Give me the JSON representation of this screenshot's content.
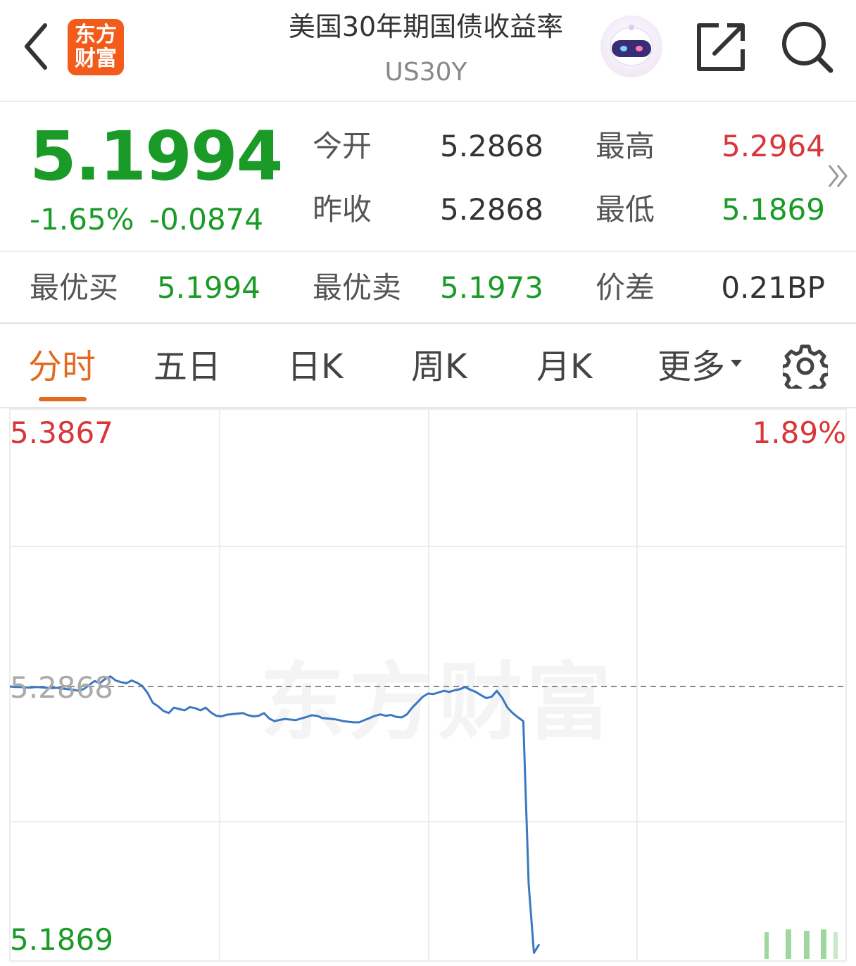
{
  "header": {
    "back_icon": "chevron-left-icon",
    "logo_line1": "东方",
    "logo_line2": "财富",
    "title": "美国30年期国债收益率",
    "subtitle": "US30Y",
    "avatar_icon": "robot-icon",
    "share_icon": "share-icon",
    "search_icon": "search-icon"
  },
  "quote": {
    "price": "5.1994",
    "change_pct": "-1.65%",
    "change_abs": "-0.0874",
    "open_label": "今开",
    "open_value": "5.2868",
    "high_label": "最高",
    "high_value": "5.2964",
    "prev_close_label": "昨收",
    "prev_close_value": "5.2868",
    "low_label": "最低",
    "low_value": "5.1869",
    "more_icon": "double-chevron-right-icon"
  },
  "bidask": {
    "bid_label": "最优买",
    "bid_value": "5.1994",
    "ask_label": "最优卖",
    "ask_value": "5.1973",
    "spread_label": "价差",
    "spread_value": "0.21BP"
  },
  "tabs": {
    "items": [
      "分时",
      "五日",
      "日K",
      "周K",
      "月K",
      "更多"
    ],
    "active_index": 0,
    "settings_icon": "gear-icon"
  },
  "colors": {
    "up": "#d8363a",
    "down": "#1a9b27",
    "accent": "#e26a22",
    "line": "#3b78c0",
    "brand": "#f35b1b"
  },
  "chart_data": {
    "type": "line",
    "y_max_label": "5.3867",
    "y_max_pct_label": "1.89%",
    "ref_label": "5.2868",
    "y_min_label": "5.1869",
    "watermark": "东方财富",
    "ylim": [
      5.1869,
      5.3867
    ],
    "reference": 5.2868,
    "grid": true,
    "x": [
      0,
      1,
      2,
      3,
      4,
      5,
      6,
      7,
      8,
      9,
      10,
      11,
      12,
      13,
      14,
      15,
      16,
      17,
      18,
      19,
      20,
      21,
      22,
      23,
      24,
      25,
      26,
      27,
      28,
      29,
      30,
      31,
      32,
      33,
      34,
      35,
      36,
      37,
      38,
      39,
      40,
      41,
      42,
      43,
      44,
      45,
      46,
      47,
      48,
      49,
      50,
      51,
      52,
      53,
      54,
      55,
      56,
      57,
      58,
      59,
      60,
      61,
      62,
      63,
      64,
      65,
      66,
      67,
      68,
      69,
      70,
      71,
      72,
      73,
      74,
      75,
      76,
      77,
      78,
      79,
      80,
      81,
      82,
      83,
      84,
      85,
      86,
      87,
      88,
      89,
      90,
      91,
      92,
      93,
      94,
      95,
      96,
      97,
      98,
      99,
      100
    ],
    "values": [
      5.2868,
      5.2866,
      5.2866,
      5.2864,
      5.2864,
      5.2866,
      5.2865,
      5.2863,
      5.2862,
      5.2863,
      5.286,
      5.2858,
      5.2856,
      5.2852,
      5.2859,
      5.2874,
      5.2888,
      5.288,
      5.2896,
      5.2905,
      5.289,
      5.2884,
      5.288,
      5.289,
      5.2882,
      5.287,
      5.2845,
      5.2808,
      5.2795,
      5.2778,
      5.277,
      5.279,
      5.2785,
      5.278,
      5.2792,
      5.2788,
      5.278,
      5.279,
      5.2772,
      5.276,
      5.2758,
      5.2764,
      5.2766,
      5.2768,
      5.277,
      5.2762,
      5.2758,
      5.276,
      5.277,
      5.275,
      5.274,
      5.2745,
      5.2748,
      5.2746,
      5.2744,
      5.275,
      5.2755,
      5.2762,
      5.276,
      5.2752,
      5.275,
      5.2748,
      5.2745,
      5.274,
      5.2738,
      5.2736,
      5.2736,
      5.2744,
      5.2752,
      5.276,
      5.2765,
      5.276,
      5.2763,
      5.2756,
      5.2754,
      5.2765,
      5.279,
      5.281,
      5.283,
      5.2842,
      5.284,
      5.2846,
      5.2852,
      5.2848,
      5.2854,
      5.2858,
      5.2866,
      5.2856,
      5.2848,
      5.2836,
      5.2825,
      5.283,
      5.2852,
      5.2826,
      5.279,
      5.277,
      5.2754,
      5.274,
      5.214,
      5.1886,
      5.1918
    ]
  }
}
